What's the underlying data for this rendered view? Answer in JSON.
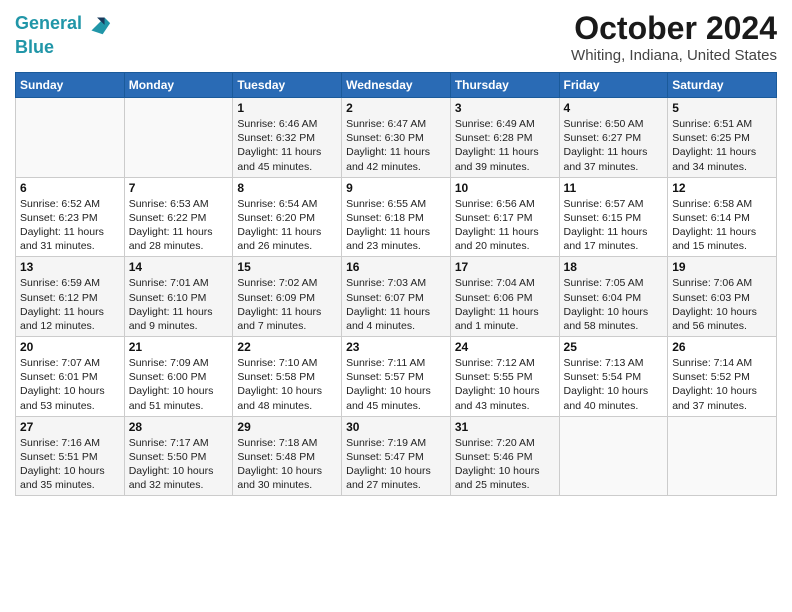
{
  "header": {
    "logo_line1": "General",
    "logo_line2": "Blue",
    "title": "October 2024",
    "subtitle": "Whiting, Indiana, United States"
  },
  "days_of_week": [
    "Sunday",
    "Monday",
    "Tuesday",
    "Wednesday",
    "Thursday",
    "Friday",
    "Saturday"
  ],
  "weeks": [
    [
      {
        "day": "",
        "info": ""
      },
      {
        "day": "",
        "info": ""
      },
      {
        "day": "1",
        "info": "Sunrise: 6:46 AM\nSunset: 6:32 PM\nDaylight: 11 hours and 45 minutes."
      },
      {
        "day": "2",
        "info": "Sunrise: 6:47 AM\nSunset: 6:30 PM\nDaylight: 11 hours and 42 minutes."
      },
      {
        "day": "3",
        "info": "Sunrise: 6:49 AM\nSunset: 6:28 PM\nDaylight: 11 hours and 39 minutes."
      },
      {
        "day": "4",
        "info": "Sunrise: 6:50 AM\nSunset: 6:27 PM\nDaylight: 11 hours and 37 minutes."
      },
      {
        "day": "5",
        "info": "Sunrise: 6:51 AM\nSunset: 6:25 PM\nDaylight: 11 hours and 34 minutes."
      }
    ],
    [
      {
        "day": "6",
        "info": "Sunrise: 6:52 AM\nSunset: 6:23 PM\nDaylight: 11 hours and 31 minutes."
      },
      {
        "day": "7",
        "info": "Sunrise: 6:53 AM\nSunset: 6:22 PM\nDaylight: 11 hours and 28 minutes."
      },
      {
        "day": "8",
        "info": "Sunrise: 6:54 AM\nSunset: 6:20 PM\nDaylight: 11 hours and 26 minutes."
      },
      {
        "day": "9",
        "info": "Sunrise: 6:55 AM\nSunset: 6:18 PM\nDaylight: 11 hours and 23 minutes."
      },
      {
        "day": "10",
        "info": "Sunrise: 6:56 AM\nSunset: 6:17 PM\nDaylight: 11 hours and 20 minutes."
      },
      {
        "day": "11",
        "info": "Sunrise: 6:57 AM\nSunset: 6:15 PM\nDaylight: 11 hours and 17 minutes."
      },
      {
        "day": "12",
        "info": "Sunrise: 6:58 AM\nSunset: 6:14 PM\nDaylight: 11 hours and 15 minutes."
      }
    ],
    [
      {
        "day": "13",
        "info": "Sunrise: 6:59 AM\nSunset: 6:12 PM\nDaylight: 11 hours and 12 minutes."
      },
      {
        "day": "14",
        "info": "Sunrise: 7:01 AM\nSunset: 6:10 PM\nDaylight: 11 hours and 9 minutes."
      },
      {
        "day": "15",
        "info": "Sunrise: 7:02 AM\nSunset: 6:09 PM\nDaylight: 11 hours and 7 minutes."
      },
      {
        "day": "16",
        "info": "Sunrise: 7:03 AM\nSunset: 6:07 PM\nDaylight: 11 hours and 4 minutes."
      },
      {
        "day": "17",
        "info": "Sunrise: 7:04 AM\nSunset: 6:06 PM\nDaylight: 11 hours and 1 minute."
      },
      {
        "day": "18",
        "info": "Sunrise: 7:05 AM\nSunset: 6:04 PM\nDaylight: 10 hours and 58 minutes."
      },
      {
        "day": "19",
        "info": "Sunrise: 7:06 AM\nSunset: 6:03 PM\nDaylight: 10 hours and 56 minutes."
      }
    ],
    [
      {
        "day": "20",
        "info": "Sunrise: 7:07 AM\nSunset: 6:01 PM\nDaylight: 10 hours and 53 minutes."
      },
      {
        "day": "21",
        "info": "Sunrise: 7:09 AM\nSunset: 6:00 PM\nDaylight: 10 hours and 51 minutes."
      },
      {
        "day": "22",
        "info": "Sunrise: 7:10 AM\nSunset: 5:58 PM\nDaylight: 10 hours and 48 minutes."
      },
      {
        "day": "23",
        "info": "Sunrise: 7:11 AM\nSunset: 5:57 PM\nDaylight: 10 hours and 45 minutes."
      },
      {
        "day": "24",
        "info": "Sunrise: 7:12 AM\nSunset: 5:55 PM\nDaylight: 10 hours and 43 minutes."
      },
      {
        "day": "25",
        "info": "Sunrise: 7:13 AM\nSunset: 5:54 PM\nDaylight: 10 hours and 40 minutes."
      },
      {
        "day": "26",
        "info": "Sunrise: 7:14 AM\nSunset: 5:52 PM\nDaylight: 10 hours and 37 minutes."
      }
    ],
    [
      {
        "day": "27",
        "info": "Sunrise: 7:16 AM\nSunset: 5:51 PM\nDaylight: 10 hours and 35 minutes."
      },
      {
        "day": "28",
        "info": "Sunrise: 7:17 AM\nSunset: 5:50 PM\nDaylight: 10 hours and 32 minutes."
      },
      {
        "day": "29",
        "info": "Sunrise: 7:18 AM\nSunset: 5:48 PM\nDaylight: 10 hours and 30 minutes."
      },
      {
        "day": "30",
        "info": "Sunrise: 7:19 AM\nSunset: 5:47 PM\nDaylight: 10 hours and 27 minutes."
      },
      {
        "day": "31",
        "info": "Sunrise: 7:20 AM\nSunset: 5:46 PM\nDaylight: 10 hours and 25 minutes."
      },
      {
        "day": "",
        "info": ""
      },
      {
        "day": "",
        "info": ""
      }
    ]
  ]
}
